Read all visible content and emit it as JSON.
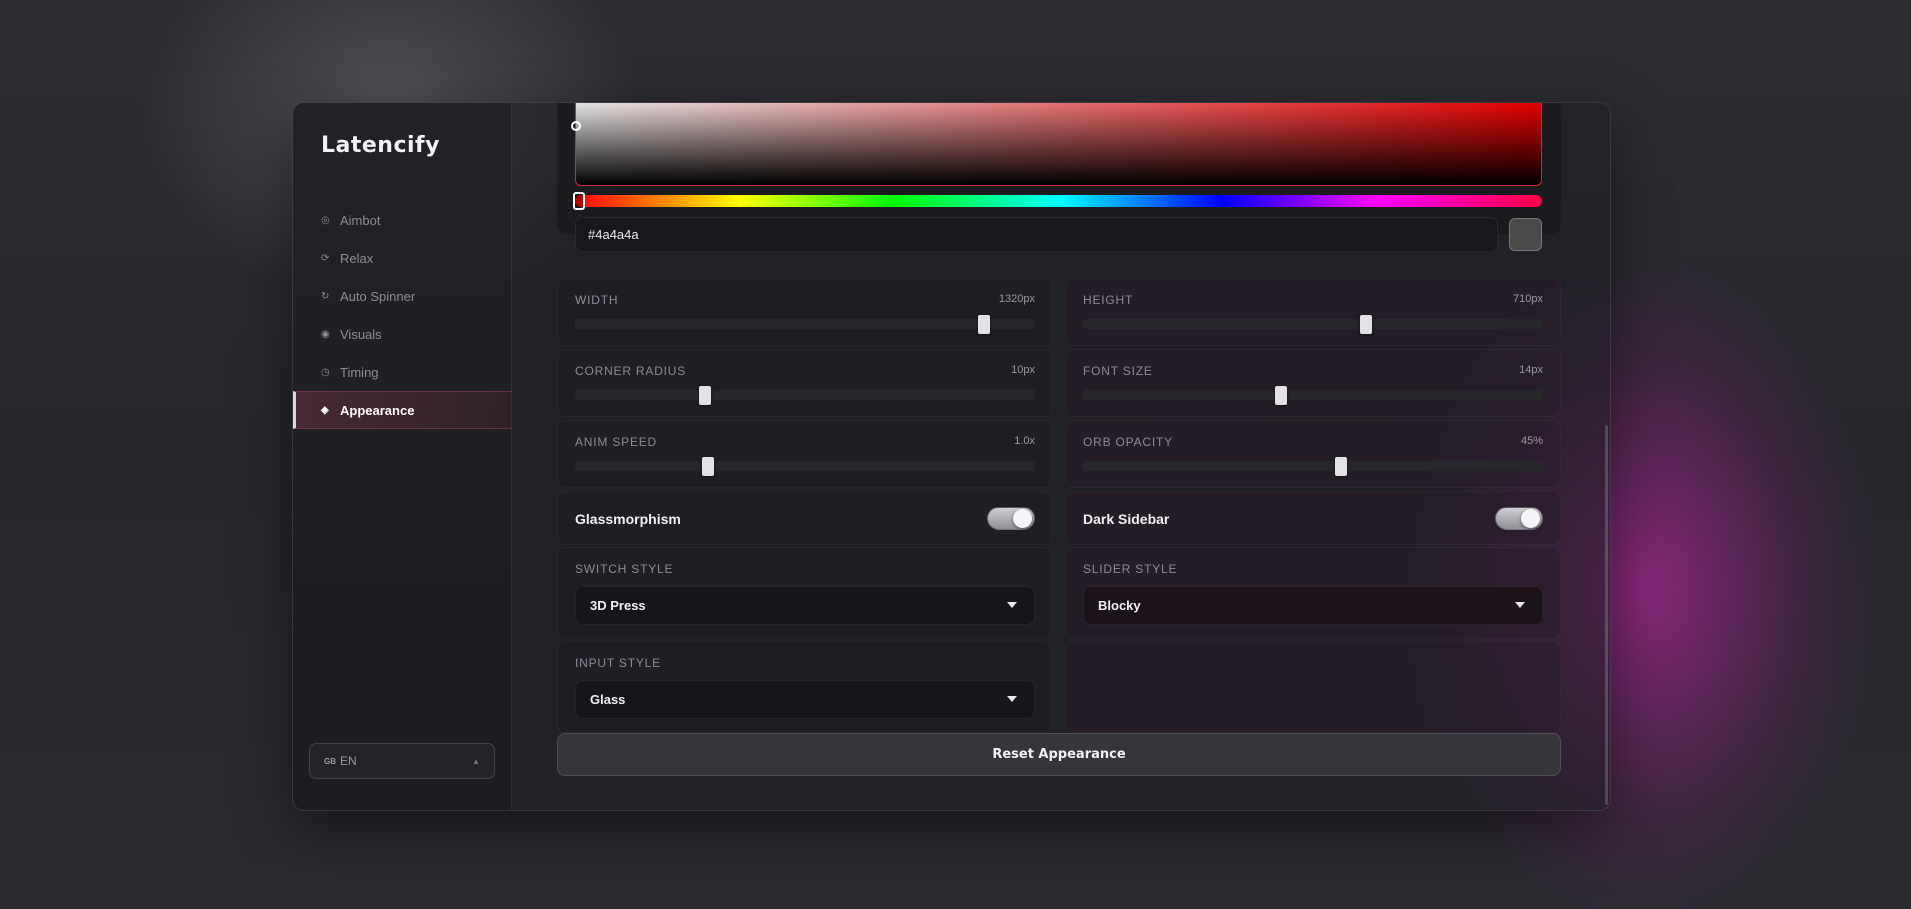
{
  "app": {
    "title": "Latencify"
  },
  "sidebar": {
    "items": [
      {
        "label": "Aimbot",
        "icon": "crosshair-icon",
        "glyph": "◎"
      },
      {
        "label": "Relax",
        "icon": "refresh-icon",
        "glyph": "⟳"
      },
      {
        "label": "Auto Spinner",
        "icon": "spinner-icon",
        "glyph": "↻"
      },
      {
        "label": "Visuals",
        "icon": "eye-icon",
        "glyph": "◉"
      },
      {
        "label": "Timing",
        "icon": "clock-icon",
        "glyph": "◷"
      },
      {
        "label": "Appearance",
        "icon": "diamond-icon",
        "glyph": "◈",
        "active": true
      }
    ],
    "language": {
      "flag": "GB",
      "label": "EN",
      "caret": "▲"
    }
  },
  "color_picker": {
    "hex": "#4a4a4a",
    "swatch_color": "#4a4a4a",
    "hue_color": "#ff0000"
  },
  "sliders": {
    "width": {
      "label": "Width",
      "value": "1320px",
      "fraction": 0.89
    },
    "height": {
      "label": "Height",
      "value": "710px",
      "fraction": 0.615
    },
    "corner_radius": {
      "label": "Corner Radius",
      "value": "10px",
      "fraction": 0.283
    },
    "font_size": {
      "label": "Font Size",
      "value": "14px",
      "fraction": 0.43
    },
    "anim_speed": {
      "label": "Anim Speed",
      "value": "1.0x",
      "fraction": 0.29
    },
    "orb_opacity": {
      "label": "Orb Opacity",
      "value": "45%",
      "fraction": 0.56
    }
  },
  "toggles": {
    "glassmorphism": {
      "label": "Glassmorphism",
      "on": true
    },
    "dark_sidebar": {
      "label": "Dark Sidebar",
      "on": true
    }
  },
  "selects": {
    "switch_style": {
      "label": "Switch Style",
      "value": "3D Press"
    },
    "slider_style": {
      "label": "Slider Style",
      "value": "Blocky"
    },
    "input_style": {
      "label": "Input Style",
      "value": "Glass"
    }
  },
  "actions": {
    "reset_label": "Reset Appearance"
  }
}
